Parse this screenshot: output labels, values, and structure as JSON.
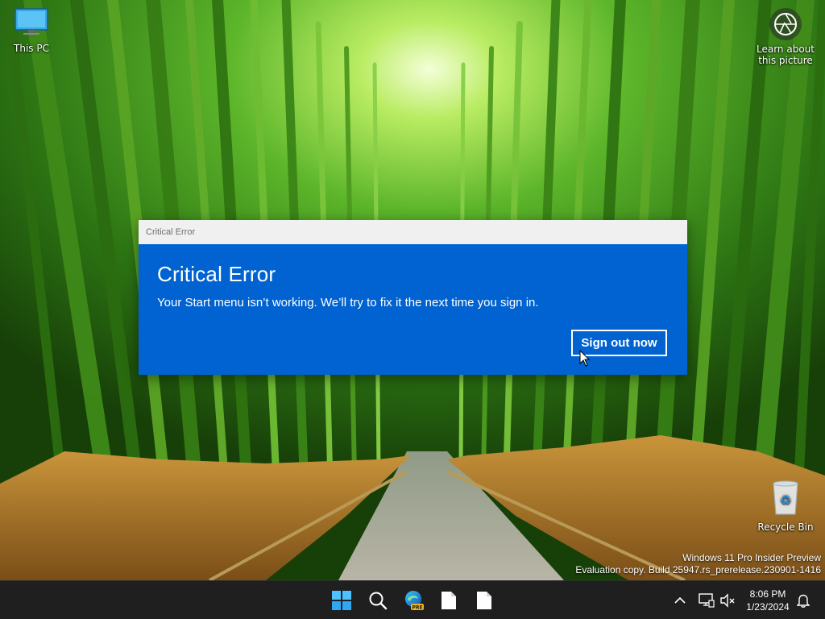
{
  "desktop": {
    "icons": {
      "this_pc": "This PC",
      "recycle_bin": "Recycle Bin",
      "learn_about_line1": "Learn about",
      "learn_about_line2": "this picture"
    }
  },
  "dialog": {
    "window_title": "Critical Error",
    "heading": "Critical Error",
    "message": "Your Start menu isn’t working. We’ll try to fix it the next time you sign in.",
    "button_label": "Sign out now",
    "accent_color": "#0063d1"
  },
  "watermark": {
    "line1": "Windows 11 Pro Insider Preview",
    "line2": "Evaluation copy. Build 25947.rs_prerelease.230901-1416"
  },
  "taskbar": {
    "apps": [
      {
        "icon": "windows-start-icon"
      },
      {
        "icon": "search-icon"
      },
      {
        "icon": "edge-beta-icon",
        "badge": "PRE"
      },
      {
        "icon": "file-icon"
      },
      {
        "icon": "file-icon"
      }
    ],
    "tray": {
      "icons": [
        "chevron-up-icon",
        "network-icon",
        "volume-muted-icon",
        "notification-bell-icon"
      ],
      "time": "8:06 PM",
      "date": "1/23/2024"
    }
  }
}
